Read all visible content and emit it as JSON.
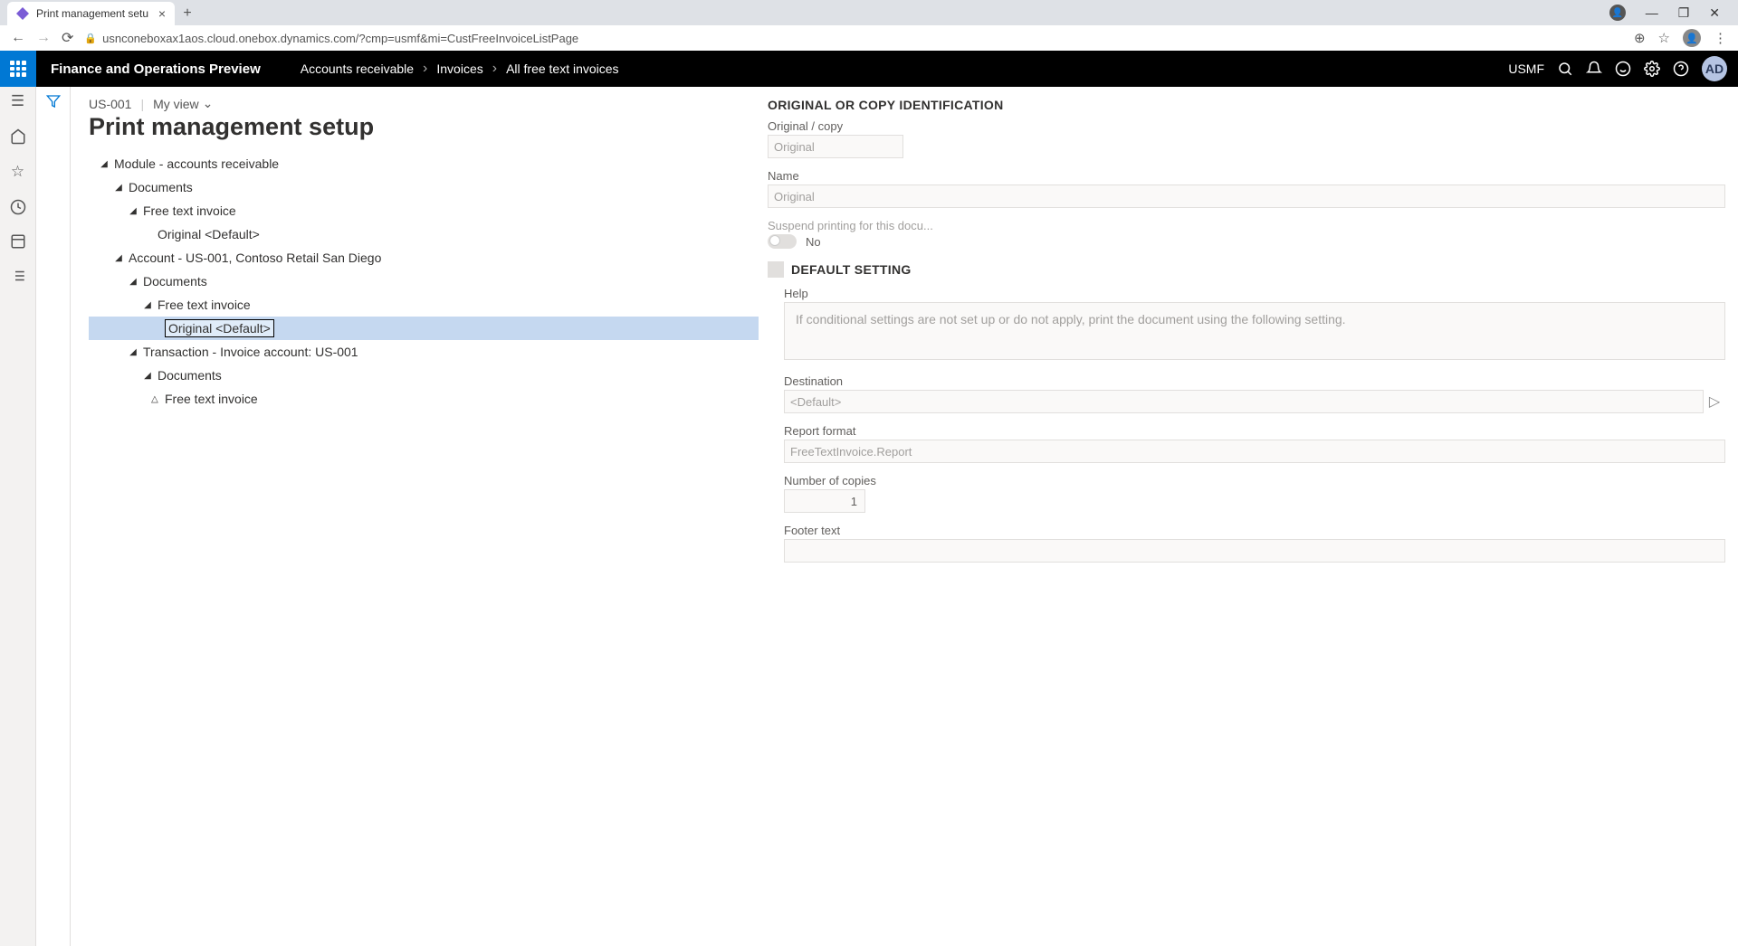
{
  "browser": {
    "tab_title": "Print management setu",
    "url": "usnconeboxax1aos.cloud.onebox.dynamics.com/?cmp=usmf&mi=CustFreeInvoiceListPage"
  },
  "app": {
    "title": "Finance and Operations Preview",
    "company": "USMF",
    "user_initials": "AD",
    "breadcrumb": [
      "Accounts receivable",
      "Invoices",
      "All free text invoices"
    ]
  },
  "page": {
    "record": "US-001",
    "view_label": "My view",
    "title": "Print management setup"
  },
  "tree": [
    {
      "depth": 0,
      "expanded": true,
      "label": "Module - accounts receivable"
    },
    {
      "depth": 1,
      "expanded": true,
      "label": "Documents"
    },
    {
      "depth": 2,
      "expanded": true,
      "label": "Free text invoice"
    },
    {
      "depth": 3,
      "expanded": null,
      "label": "Original <Default>"
    },
    {
      "depth": 1,
      "expanded": true,
      "label": "Account - US-001, Contoso Retail San Diego"
    },
    {
      "depth": 2,
      "expanded": true,
      "label": "Documents"
    },
    {
      "depth": 3,
      "expanded": true,
      "label": "Free text invoice"
    },
    {
      "depth": 4,
      "expanded": null,
      "label": "Original <Default>",
      "selected": true
    },
    {
      "depth": 2,
      "expanded": true,
      "label": "Transaction - Invoice account: US-001"
    },
    {
      "depth": 3,
      "expanded": true,
      "label": "Documents"
    },
    {
      "depth": 4,
      "expanded": false,
      "label": "Free text invoice"
    }
  ],
  "detail": {
    "section_id": "ORIGINAL OR COPY IDENTIFICATION",
    "original_copy_label": "Original / copy",
    "original_copy_value": "Original",
    "name_label": "Name",
    "name_value": "Original",
    "suspend_label": "Suspend printing for this docu...",
    "suspend_value": "No",
    "default_heading": "DEFAULT SETTING",
    "help_label": "Help",
    "help_text": "If conditional settings are not set up or do not apply, print the document using the following setting.",
    "destination_label": "Destination",
    "destination_value": "<Default>",
    "report_format_label": "Report format",
    "report_format_value": "FreeTextInvoice.Report",
    "copies_label": "Number of copies",
    "copies_value": "1",
    "footer_label": "Footer text"
  }
}
